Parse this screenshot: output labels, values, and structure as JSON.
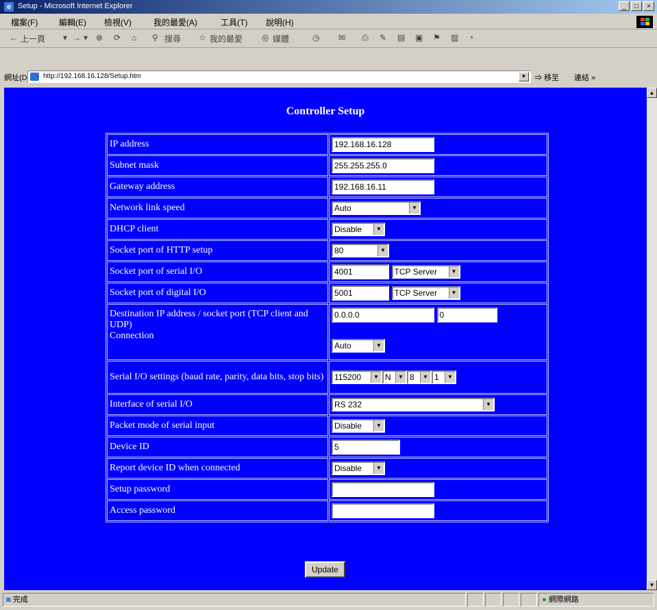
{
  "window": {
    "title": "Setup - Microsoft Internet Explorer",
    "controls": [
      "_",
      "□",
      "×"
    ]
  },
  "menu": [
    "檔案(F)",
    "編輯(E)",
    "檢視(V)",
    "我的最愛(A)",
    "工具(T)",
    "說明(H)"
  ],
  "toolbar": {
    "back": "上一頁",
    "search": "搜尋",
    "favorites": "我的最愛",
    "media": "媒體"
  },
  "address": {
    "label": "網址(D)",
    "url": "http://192.168.16.128/Setup.htm",
    "go": "移至",
    "links": "連結"
  },
  "page": {
    "heading": "Controller Setup",
    "update_label": "Update"
  },
  "fields": {
    "ip": {
      "label": "IP address",
      "value": "192.168.16.128"
    },
    "subnet": {
      "label": "Subnet mask",
      "value": "255.255.255.0"
    },
    "gateway": {
      "label": "Gateway address",
      "value": "192.168.16.11"
    },
    "link_speed": {
      "label": "Network link speed",
      "value": "Auto"
    },
    "dhcp": {
      "label": "DHCP client",
      "value": "Disable"
    },
    "http_port": {
      "label": "Socket port of HTTP setup",
      "value": "80"
    },
    "serial_port": {
      "label": "Socket port of serial I/O",
      "value": "4001",
      "mode": "TCP Server"
    },
    "digital_port": {
      "label": "Socket port of digital I/O",
      "value": "5001",
      "mode": "TCP Server"
    },
    "dest": {
      "label": "Destination IP address / socket port (TCP client and UDP)",
      "ip": "0.0.0.0",
      "port": "0",
      "connection_label": "Connection",
      "connection": "Auto"
    },
    "serial_settings": {
      "label": "Serial I/O settings (baud rate, parity, data bits, stop bits)",
      "baud": "115200",
      "parity": "N",
      "data_bits": "8",
      "stop_bits": "1"
    },
    "interface": {
      "label": "Interface of serial I/O",
      "value": "RS 232"
    },
    "packet_mode": {
      "label": "Packet mode of serial input",
      "value": "Disable"
    },
    "device_id": {
      "label": "Device ID",
      "value": "5"
    },
    "report_id": {
      "label": "Report device ID when connected",
      "value": "Disable"
    },
    "setup_password": {
      "label": "Setup password",
      "value": ""
    },
    "access_password": {
      "label": "Access password",
      "value": ""
    }
  },
  "status": {
    "left": "完成",
    "zone": "網際網路"
  }
}
